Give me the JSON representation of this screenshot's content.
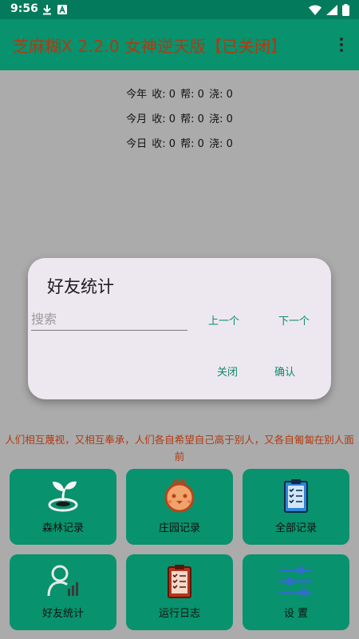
{
  "status_bar": {
    "time": "9:56"
  },
  "app_bar": {
    "title": "芝麻糊X 2.2.0 女神逆天版【已关闭】"
  },
  "stats": [
    {
      "period": "今年",
      "shou": "收: 0",
      "bang": "帮: 0",
      "jiao": "浇: 0"
    },
    {
      "period": "今月",
      "shou": "收: 0",
      "bang": "帮: 0",
      "jiao": "浇: 0"
    },
    {
      "period": "今日",
      "shou": "收: 0",
      "bang": "帮: 0",
      "jiao": "浇: 0"
    }
  ],
  "dialog": {
    "title": "好友统计",
    "search_placeholder": "搜索",
    "search_value": "",
    "prev_label": "上一个",
    "next_label": "下一个",
    "close_label": "关闭",
    "confirm_label": "确认"
  },
  "quote": "人们相互蔑视，又相互奉承，人们各自希望自己高于别人，又各自匍匐在别人面前",
  "tiles": [
    {
      "label": "森林记录",
      "icon": "sprout-icon"
    },
    {
      "label": "庄园记录",
      "icon": "chick-icon"
    },
    {
      "label": "全部记录",
      "icon": "clipboard-icon"
    },
    {
      "label": "好友统计",
      "icon": "user-stats-icon"
    },
    {
      "label": "运行日志",
      "icon": "log-clipboard-icon"
    },
    {
      "label": "设 置",
      "icon": "sliders-icon"
    }
  ],
  "colors": {
    "status_bar": "#047a5c",
    "app_bar": "#08926d",
    "tile": "#08926d",
    "accent_text": "#b13a12",
    "dialog_button": "#0c8a6a"
  }
}
